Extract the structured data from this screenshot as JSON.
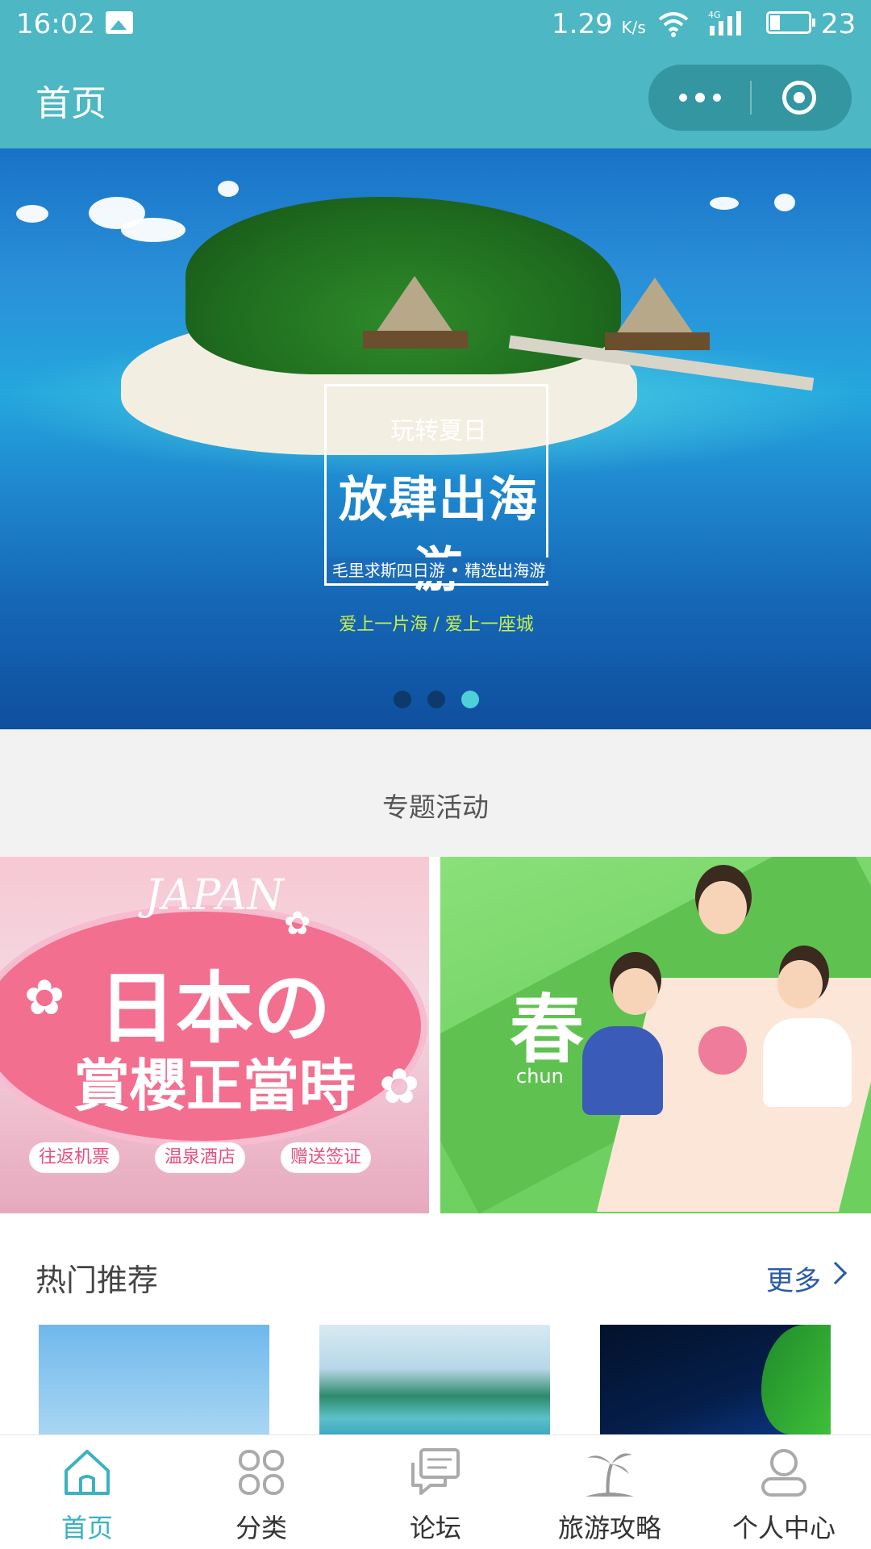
{
  "status_bar": {
    "time": "16:02",
    "speed": "1.29",
    "speed_unit": "K/s",
    "network": "4G",
    "battery": "23"
  },
  "header": {
    "title": "首页",
    "capsule_more_icon": "more-dots-icon",
    "capsule_close_icon": "target-circle-icon",
    "bg_color": "#4db7c4"
  },
  "banner": {
    "small_title": "玩转夏日",
    "big_title": "放肆出海游",
    "subtitle": "毛里求斯四日游 • 精选出海游",
    "tagline": "爱上一片海 / 爱上一座城",
    "total_slides": 3,
    "active_slide": 3
  },
  "section": {
    "title": "专题活动"
  },
  "cards": {
    "japan": {
      "word": "JAPAN",
      "line1": "日本の",
      "line2": "賞櫻正當時",
      "tags": [
        "往返机票",
        "温泉酒店",
        "赠送签证"
      ]
    },
    "spring": {
      "char": "春",
      "word": "chun"
    }
  },
  "hot": {
    "title": "热门推荐",
    "more": "更多"
  },
  "tabbar": {
    "active_color": "#3bb2c2",
    "tabs": [
      {
        "label": "首页",
        "icon": "home-icon"
      },
      {
        "label": "分类",
        "icon": "category-grid-icon"
      },
      {
        "label": "论坛",
        "icon": "forum-chat-icon"
      },
      {
        "label": "旅游攻略",
        "icon": "palm-tree-icon"
      },
      {
        "label": "个人中心",
        "icon": "user-icon"
      }
    ]
  }
}
